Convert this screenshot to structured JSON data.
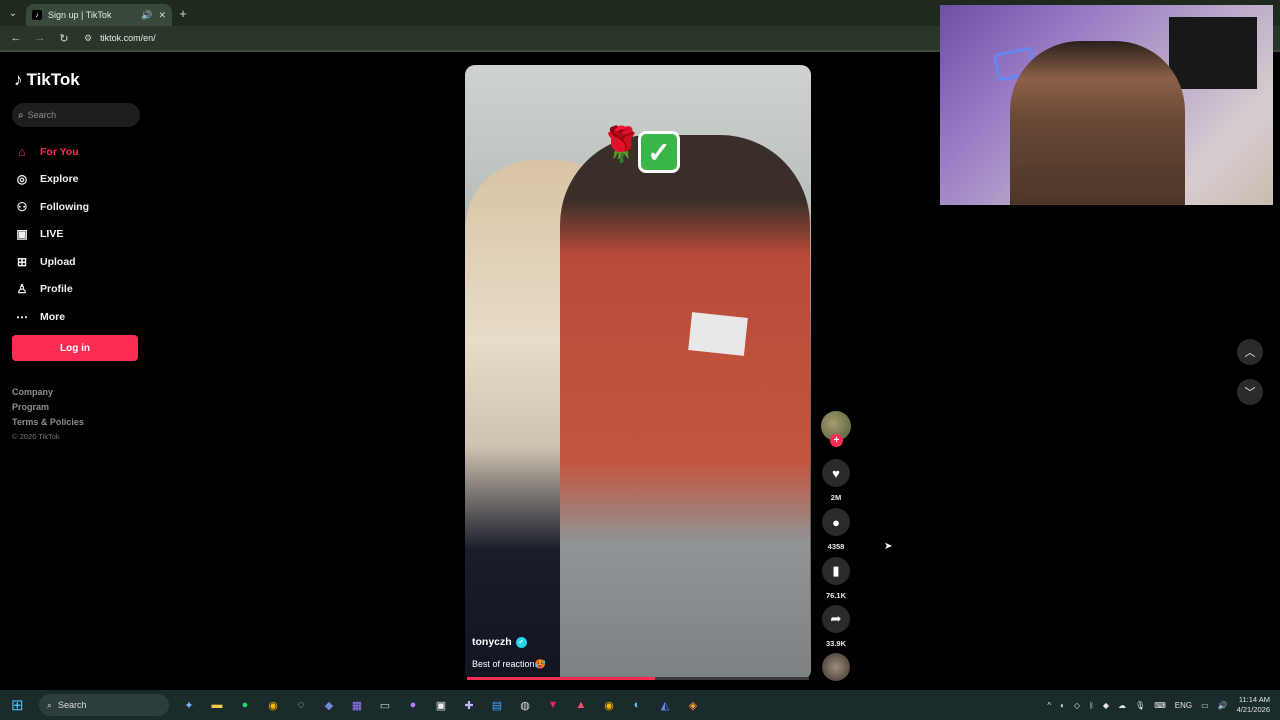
{
  "browser": {
    "tab_title": "Sign up | TikTok",
    "url": "tiktok.com/en/"
  },
  "sidebar": {
    "brand": "TikTok",
    "search_placeholder": "Search",
    "nav": [
      {
        "label": "For You",
        "icon": "home-icon"
      },
      {
        "label": "Explore",
        "icon": "compass-icon"
      },
      {
        "label": "Following",
        "icon": "user-follow-icon"
      },
      {
        "label": "LIVE",
        "icon": "live-icon"
      },
      {
        "label": "Upload",
        "icon": "upload-icon"
      },
      {
        "label": "Profile",
        "icon": "profile-icon"
      },
      {
        "label": "More",
        "icon": "more-icon"
      }
    ],
    "login_label": "Log in",
    "footer_links": [
      "Company",
      "Program",
      "Terms & Policies"
    ],
    "copyright": "© 2026 TikTok"
  },
  "video": {
    "username": "tonyczh",
    "description": "Best of reaction🥵",
    "progress": 0.55,
    "stats": {
      "likes": "2M",
      "comments": "4358",
      "saves": "76.1K",
      "shares": "33.9K"
    }
  },
  "taskbar": {
    "search_label": "Search",
    "language": "ENG",
    "time": "11:14 AM",
    "date": "4/21/2026"
  },
  "colors": {
    "accent": "#fe2c55",
    "verified": "#20d5ec"
  }
}
